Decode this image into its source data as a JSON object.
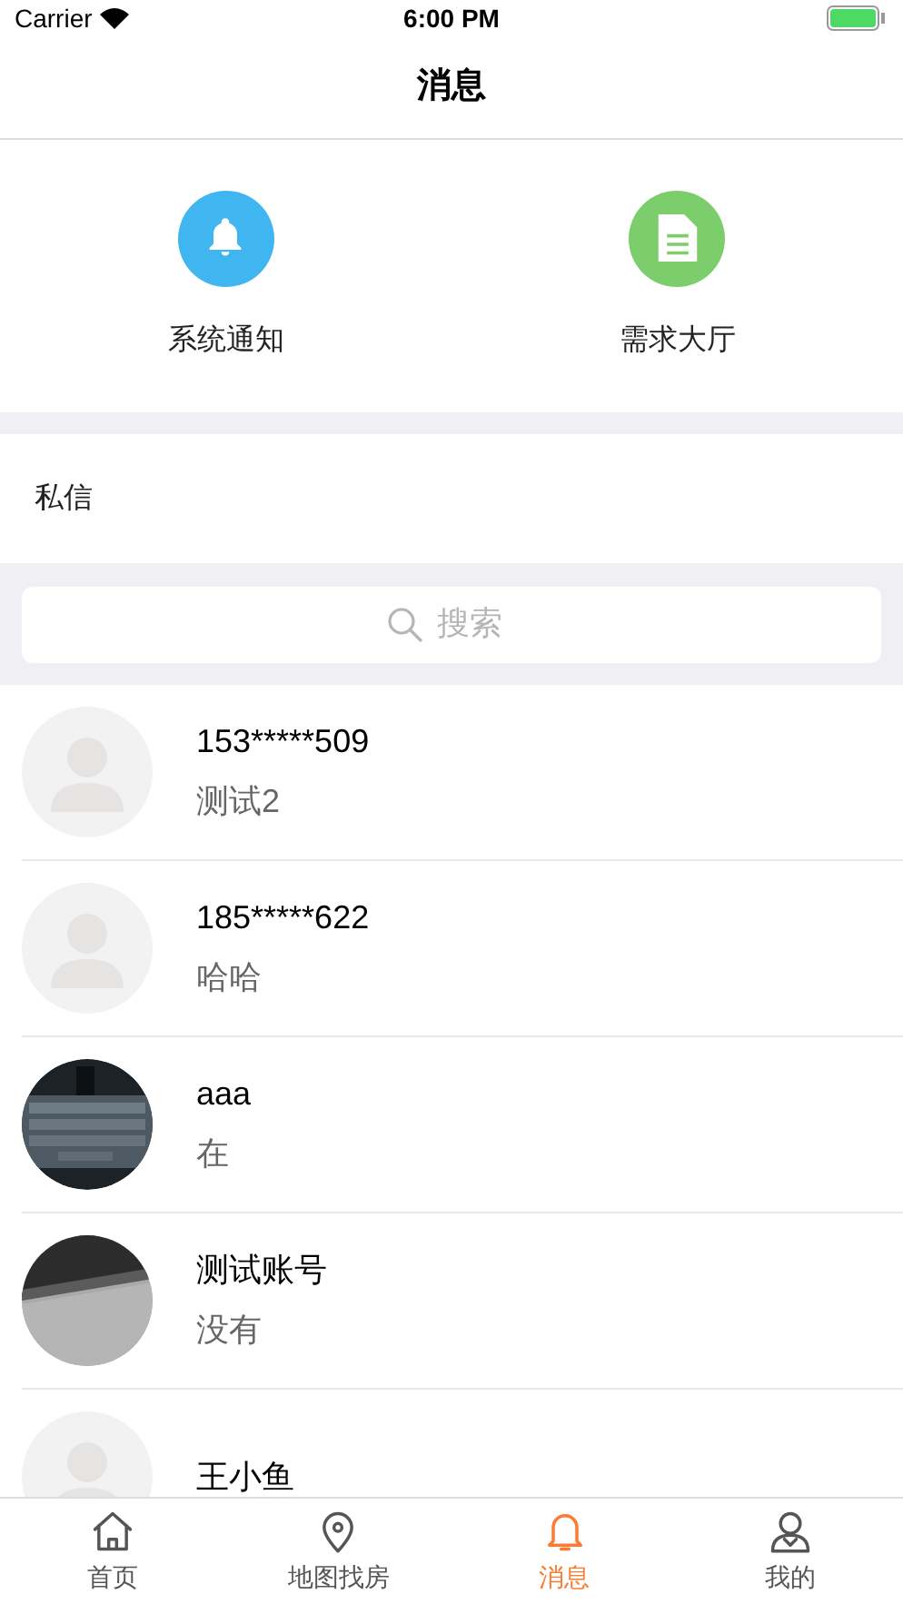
{
  "status_bar": {
    "carrier": "Carrier",
    "time": "6:00 PM"
  },
  "nav": {
    "title": "消息"
  },
  "shortcuts": [
    {
      "label": "系统通知",
      "kind": "bell",
      "color": "#3fb6f0"
    },
    {
      "label": "需求大厅",
      "kind": "document",
      "color": "#7ccd6b"
    }
  ],
  "section": {
    "title": "私信"
  },
  "search": {
    "placeholder": "搜索"
  },
  "conversations": [
    {
      "name": "153*****509",
      "message": "测试2",
      "kind": "default"
    },
    {
      "name": "185*****622",
      "message": "哈哈",
      "kind": "default"
    },
    {
      "name": "aaa",
      "message": "在",
      "kind": "keyboard"
    },
    {
      "name": "测试账号",
      "message": "没有",
      "kind": "laptop"
    },
    {
      "name": "王小鱼",
      "kind": "default"
    }
  ],
  "tab_bar": [
    {
      "label": "首页",
      "kind": "home",
      "selected": false
    },
    {
      "label": "地图找房",
      "kind": "map",
      "selected": false
    },
    {
      "label": "消息",
      "kind": "bell",
      "selected": true
    },
    {
      "label": "我的",
      "kind": "user",
      "selected": false
    }
  ]
}
